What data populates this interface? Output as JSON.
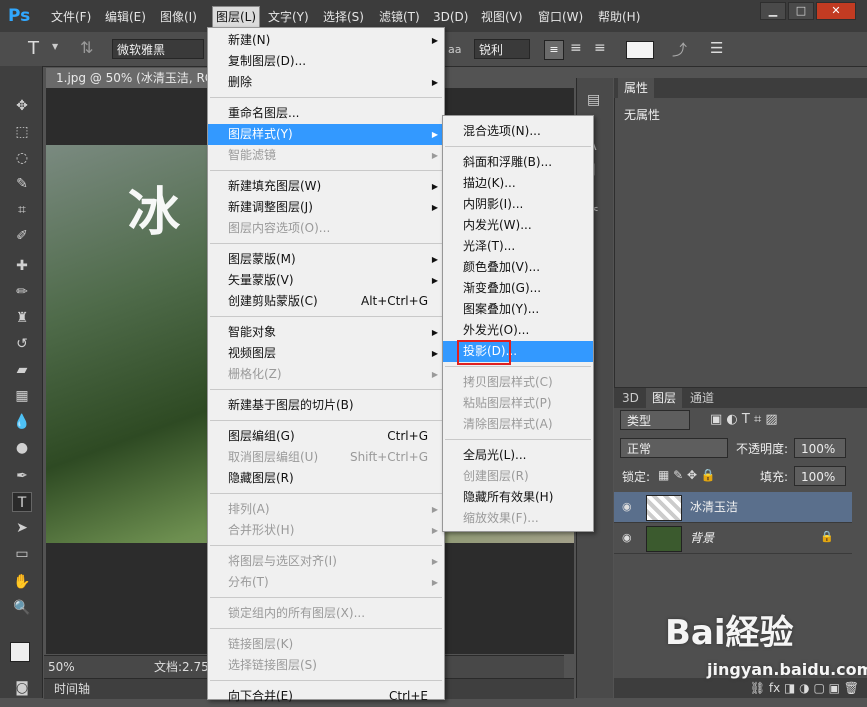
{
  "app_logo": "Ps",
  "menubar": [
    "文件(F)",
    "编辑(E)",
    "图像(I)",
    "图层(L)",
    "文字(Y)",
    "选择(S)",
    "滤镜(T)",
    "3D(D)",
    "视图(V)",
    "窗口(W)",
    "帮助(H)"
  ],
  "window_controls": [
    "▁",
    "□",
    "✕"
  ],
  "options": {
    "tool_icon": "T",
    "font_family": "微软雅黑",
    "antialias": "锐利",
    "aa_icon": "aa"
  },
  "document": {
    "tab_title": "1.jpg @ 50% (冰清玉洁, RGE",
    "canvas_text": "冰",
    "zoom": "50%",
    "doc_size": "文档:2.75"
  },
  "timeline_label": "时间轴",
  "properties": {
    "tab": "属性",
    "content": "无属性"
  },
  "layers_panel": {
    "tabs": [
      "3D",
      "图层",
      "通道"
    ],
    "filter": "类型",
    "blend_mode": "正常",
    "opacity_label": "不透明度:",
    "opacity_value": "100%",
    "lock_label": "锁定:",
    "fill_label": "填充:",
    "fill_value": "100%",
    "layers": [
      {
        "name": "冰清玉洁"
      },
      {
        "name": "背景"
      }
    ]
  },
  "layer_menu": [
    {
      "label": "新建(N)",
      "arrow": true
    },
    {
      "label": "复制图层(D)..."
    },
    {
      "label": "删除",
      "arrow": true
    },
    {
      "sep": true
    },
    {
      "label": "重命名图层..."
    },
    {
      "label": "图层样式(Y)",
      "arrow": true,
      "hl": true
    },
    {
      "label": "智能滤镜",
      "arrow": true,
      "dis": true
    },
    {
      "sep": true
    },
    {
      "label": "新建填充图层(W)",
      "arrow": true
    },
    {
      "label": "新建调整图层(J)",
      "arrow": true
    },
    {
      "label": "图层内容选项(O)...",
      "dis": true
    },
    {
      "sep": true
    },
    {
      "label": "图层蒙版(M)",
      "arrow": true
    },
    {
      "label": "矢量蒙版(V)",
      "arrow": true
    },
    {
      "label": "创建剪贴蒙版(C)",
      "sc": "Alt+Ctrl+G"
    },
    {
      "sep": true
    },
    {
      "label": "智能对象",
      "arrow": true
    },
    {
      "label": "视频图层",
      "arrow": true
    },
    {
      "label": "栅格化(Z)",
      "arrow": true,
      "dis": true
    },
    {
      "sep": true
    },
    {
      "label": "新建基于图层的切片(B)"
    },
    {
      "sep": true
    },
    {
      "label": "图层编组(G)",
      "sc": "Ctrl+G"
    },
    {
      "label": "取消图层编组(U)",
      "sc": "Shift+Ctrl+G",
      "dis": true
    },
    {
      "label": "隐藏图层(R)"
    },
    {
      "sep": true
    },
    {
      "label": "排列(A)",
      "arrow": true,
      "dis": true
    },
    {
      "label": "合并形状(H)",
      "arrow": true,
      "dis": true
    },
    {
      "sep": true
    },
    {
      "label": "将图层与选区对齐(I)",
      "arrow": true,
      "dis": true
    },
    {
      "label": "分布(T)",
      "arrow": true,
      "dis": true
    },
    {
      "sep": true
    },
    {
      "label": "锁定组内的所有图层(X)...",
      "dis": true
    },
    {
      "sep": true
    },
    {
      "label": "链接图层(K)",
      "dis": true
    },
    {
      "label": "选择链接图层(S)",
      "dis": true
    },
    {
      "sep": true
    },
    {
      "label": "向下合并(E)",
      "sc": "Ctrl+E"
    }
  ],
  "style_menu": [
    {
      "label": "混合选项(N)..."
    },
    {
      "sep": true
    },
    {
      "label": "斜面和浮雕(B)..."
    },
    {
      "label": "描边(K)..."
    },
    {
      "label": "内阴影(I)..."
    },
    {
      "label": "内发光(W)..."
    },
    {
      "label": "光泽(T)..."
    },
    {
      "label": "颜色叠加(V)..."
    },
    {
      "label": "渐变叠加(G)..."
    },
    {
      "label": "图案叠加(Y)..."
    },
    {
      "label": "外发光(O)..."
    },
    {
      "label": "投影(D)...",
      "hl": true
    },
    {
      "sep": true
    },
    {
      "label": "拷贝图层样式(C)",
      "dis": true
    },
    {
      "label": "粘贴图层样式(P)",
      "dis": true
    },
    {
      "label": "清除图层样式(A)",
      "dis": true
    },
    {
      "sep": true
    },
    {
      "label": "全局光(L)..."
    },
    {
      "label": "创建图层(R)",
      "dis": true
    },
    {
      "label": "隐藏所有效果(H)"
    },
    {
      "label": "缩放效果(F)...",
      "dis": true
    }
  ],
  "watermark": {
    "text": "Bai経验",
    "url": "jingyan.baidu.com"
  }
}
